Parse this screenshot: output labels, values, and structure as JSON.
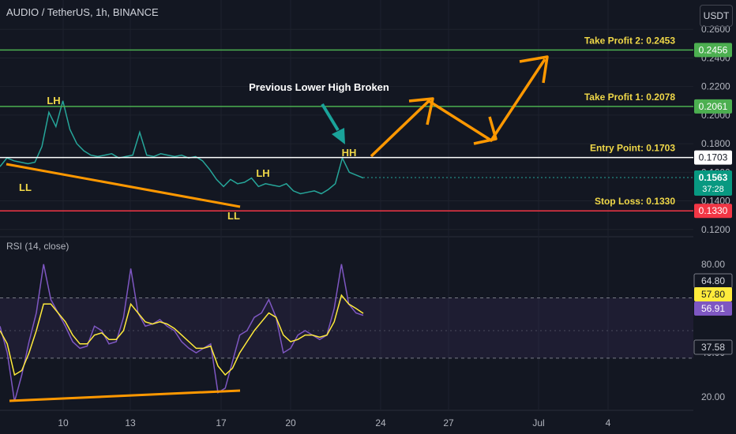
{
  "header": {
    "symbol_title": "AUDIO / TetherUS, 1h, BINANCE",
    "currency": "USDT"
  },
  "rsi_title": "RSI (14, close)",
  "colors": {
    "bg": "#131722",
    "grid": "#1e222d",
    "price": "#26a69a",
    "price_down": "#ef5350",
    "white_line": "#ffffff",
    "tp_line": "#4caf50",
    "sl_line": "#f23645",
    "arrow": "#ff9800",
    "teal_arrow": "#1aa39a",
    "rsi_line": "#7e57c2",
    "rsi_ma": "#ffeb3b",
    "label_yellow": "#f0d848"
  },
  "chart_data": [
    {
      "type": "line",
      "name": "price",
      "x_ticks": [
        "10",
        "13",
        "17",
        "20",
        "24",
        "27",
        "Jul",
        "4"
      ],
      "y_ticks": [
        "0.2600",
        "0.2400",
        "0.2200",
        "0.2000",
        "0.1800",
        "0.1600",
        "0.1400",
        "0.1200"
      ],
      "ylim": [
        0.116,
        0.264
      ],
      "series": [
        {
          "values": [
            0.164,
            0.17,
            0.168,
            0.167,
            0.166,
            0.167,
            0.178,
            0.202,
            0.192,
            0.21,
            0.19,
            0.18,
            0.175,
            0.172,
            0.171,
            0.172,
            0.173,
            0.17,
            0.171,
            0.172,
            0.188,
            0.172,
            0.171,
            0.173,
            0.172,
            0.171,
            0.172,
            0.17,
            0.171,
            0.168,
            0.162,
            0.155,
            0.15,
            0.155,
            0.152,
            0.153,
            0.156,
            0.15,
            0.152,
            0.151,
            0.15,
            0.152,
            0.147,
            0.145,
            0.146,
            0.147,
            0.145,
            0.148,
            0.152,
            0.17,
            0.16,
            0.158,
            0.156
          ]
        }
      ],
      "levels": [
        {
          "value": 0.2456,
          "label": "Take Profit 2: 0.2453",
          "tag": "0.2456"
        },
        {
          "value": 0.2061,
          "label": "Take Profit 1: 0.2078",
          "tag": "0.2061"
        },
        {
          "value": 0.1703,
          "label": "Entry Point: 0.1703",
          "tag": "0.1703"
        },
        {
          "value": 0.133,
          "label": "Stop Loss: 0.1330",
          "tag": "0.1330"
        }
      ],
      "current_price": {
        "value": "0.1563",
        "countdown": "37:28"
      },
      "annotations": {
        "pivots": [
          "LH",
          "LL",
          "LL",
          "LH",
          "HH"
        ],
        "note": "Previous Lower High Broken"
      }
    },
    {
      "type": "line",
      "name": "rsi",
      "y_ticks": [
        "80.00",
        "40.00",
        "20.00"
      ],
      "ylim": [
        14,
        86
      ],
      "bands": [
        64.8,
        37.58
      ],
      "series": [
        {
          "values": [
            52,
            40,
            18,
            30,
            45,
            58,
            80,
            64,
            58,
            52,
            45,
            42,
            43,
            52,
            50,
            44,
            45,
            56,
            78,
            58,
            52,
            53,
            55,
            52,
            50,
            45,
            42,
            40,
            42,
            44,
            22,
            24,
            36,
            48,
            50,
            56,
            58,
            64,
            56,
            40,
            42,
            48,
            50,
            48,
            46,
            48,
            60,
            80,
            62,
            58,
            56.91
          ]
        },
        {
          "values": [
            50,
            44,
            30,
            32,
            40,
            50,
            62,
            62,
            58,
            54,
            48,
            44,
            44,
            48,
            49,
            46,
            46,
            50,
            62,
            58,
            54,
            53,
            54,
            53,
            51,
            48,
            45,
            42,
            42,
            43,
            34,
            30,
            33,
            40,
            45,
            50,
            54,
            58,
            56,
            48,
            45,
            46,
            48,
            48,
            47,
            48,
            54,
            66,
            62,
            60,
            57.8
          ]
        }
      ],
      "tags": [
        "64.80",
        "57.80",
        "56.91",
        "37.58"
      ]
    }
  ]
}
